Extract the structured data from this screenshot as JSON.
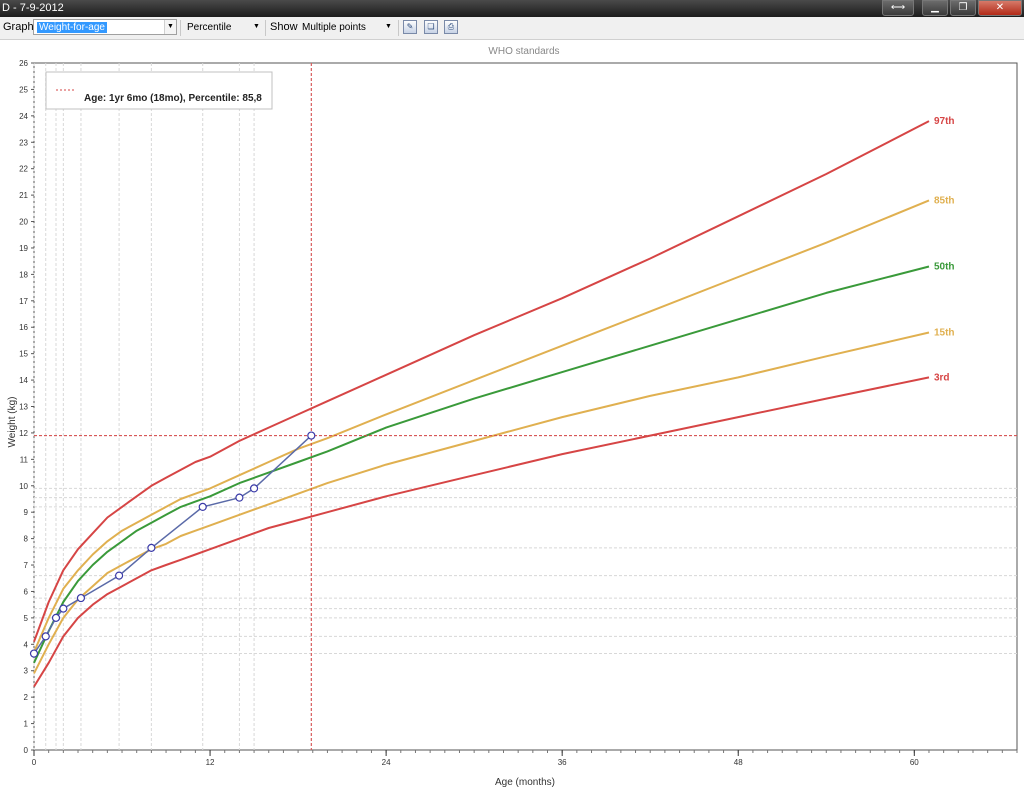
{
  "window": {
    "title": "D - 7-9-2012",
    "buttons": {
      "swap": "⟷",
      "minimize": "▁",
      "maximize": "❐",
      "close": "✕"
    }
  },
  "toolbar": {
    "graph_label": "Graph",
    "graph_value": "Weight-for-age",
    "mode_value": "Percentile",
    "show_label": "Show",
    "show_value": "Multiple points",
    "icons": [
      "chart-settings-icon",
      "copy-icon",
      "print-icon"
    ]
  },
  "colors": {
    "p97": "#d64545",
    "p85": "#e0b050",
    "p50": "#3a9a3a",
    "p15": "#e0b050",
    "p3": "#d64545",
    "child": "#5a6aa8",
    "marker": "#d64545",
    "grid": "#d8d8d8"
  },
  "chart_data": {
    "type": "line",
    "title": "WHO standards",
    "xlabel": "Age (months)",
    "ylabel": "Weight (kg)",
    "xlim": [
      0,
      67
    ],
    "ylim": [
      0,
      26
    ],
    "xticks": [
      0,
      12,
      24,
      36,
      48,
      60
    ],
    "yticks": [
      0,
      1,
      2,
      3,
      4,
      5,
      6,
      7,
      8,
      9,
      10,
      11,
      12,
      13,
      14,
      15,
      16,
      17,
      18,
      19,
      20,
      21,
      22,
      23,
      24,
      25,
      26
    ],
    "x": [
      0,
      1,
      2,
      3,
      4,
      5,
      6,
      7,
      8,
      9,
      10,
      11,
      12,
      14,
      16,
      18,
      20,
      24,
      30,
      36,
      42,
      48,
      54,
      61
    ],
    "series": [
      {
        "name": "97th",
        "color_key": "p97",
        "values": [
          4.1,
          5.6,
          6.8,
          7.6,
          8.2,
          8.8,
          9.2,
          9.6,
          10.0,
          10.3,
          10.6,
          10.9,
          11.1,
          11.7,
          12.2,
          12.7,
          13.2,
          14.2,
          15.7,
          17.1,
          18.6,
          20.2,
          21.8,
          23.8
        ]
      },
      {
        "name": "85th",
        "color_key": "p85",
        "values": [
          3.7,
          5.0,
          6.1,
          6.8,
          7.4,
          7.9,
          8.3,
          8.6,
          8.9,
          9.2,
          9.5,
          9.7,
          9.9,
          10.4,
          10.9,
          11.4,
          11.8,
          12.7,
          14.0,
          15.3,
          16.6,
          17.9,
          19.2,
          20.8
        ]
      },
      {
        "name": "50th",
        "color_key": "p50",
        "values": [
          3.3,
          4.5,
          5.6,
          6.4,
          7.0,
          7.5,
          7.9,
          8.3,
          8.6,
          8.9,
          9.2,
          9.4,
          9.6,
          10.1,
          10.5,
          10.9,
          11.3,
          12.2,
          13.3,
          14.3,
          15.3,
          16.3,
          17.3,
          18.3
        ]
      },
      {
        "name": "15th",
        "color_key": "p15",
        "values": [
          2.9,
          4.0,
          5.0,
          5.7,
          6.2,
          6.7,
          7.0,
          7.3,
          7.6,
          7.8,
          8.1,
          8.3,
          8.5,
          8.9,
          9.3,
          9.7,
          10.1,
          10.8,
          11.7,
          12.6,
          13.4,
          14.1,
          14.9,
          15.8
        ]
      },
      {
        "name": "3rd",
        "color_key": "p3",
        "values": [
          2.4,
          3.3,
          4.3,
          5.0,
          5.5,
          5.9,
          6.2,
          6.5,
          6.8,
          7.0,
          7.2,
          7.4,
          7.6,
          8.0,
          8.4,
          8.7,
          9.0,
          9.6,
          10.4,
          11.2,
          11.9,
          12.6,
          13.3,
          14.1
        ]
      }
    ],
    "child_points": {
      "name": "",
      "x": [
        0,
        0.8,
        1.5,
        2,
        3.2,
        5.8,
        8,
        11.5,
        14,
        15,
        18.9
      ],
      "y": [
        3.65,
        4.3,
        5.0,
        5.35,
        5.75,
        6.6,
        7.65,
        9.2,
        9.55,
        9.9,
        11.9
      ]
    },
    "crosshair": {
      "x": 18.9,
      "y": 11.9
    },
    "legend": {
      "placement": "top-left",
      "entry": "Age: 1yr 6mo (18mo), Percentile: 85,8"
    },
    "grid": true
  }
}
